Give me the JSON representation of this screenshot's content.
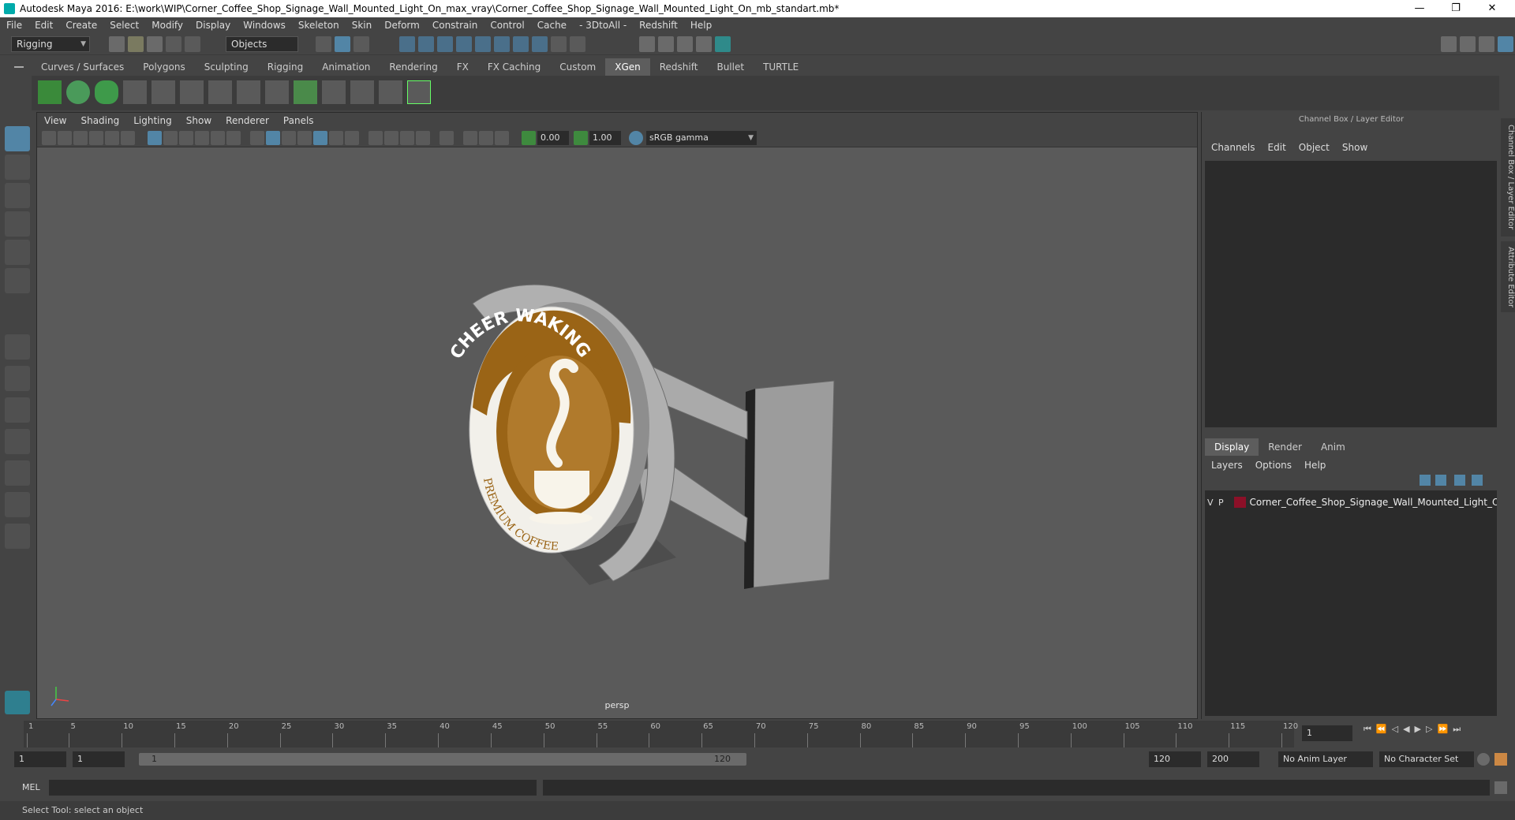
{
  "titlebar": {
    "title": "Autodesk Maya 2016: E:\\work\\WIP\\Corner_Coffee_Shop_Signage_Wall_Mounted_Light_On_max_vray\\Corner_Coffee_Shop_Signage_Wall_Mounted_Light_On_mb_standart.mb*",
    "minimize": "—",
    "restore": "❐",
    "close": "✕"
  },
  "menubar": {
    "items": [
      "File",
      "Edit",
      "Create",
      "Select",
      "Modify",
      "Display",
      "Windows",
      "Skeleton",
      "Skin",
      "Deform",
      "Constrain",
      "Control",
      "Cache",
      "- 3DtoAll -",
      "Redshift",
      "Help"
    ]
  },
  "toolbar": {
    "mode": "Rigging",
    "select_mask": "Objects"
  },
  "shelf": {
    "tabs": [
      "Curves / Surfaces",
      "Polygons",
      "Sculpting",
      "Rigging",
      "Animation",
      "Rendering",
      "FX",
      "FX Caching",
      "Custom",
      "XGen",
      "Redshift",
      "Bullet",
      "TURTLE"
    ],
    "active_tab": "XGen"
  },
  "viewport": {
    "menu": [
      "View",
      "Shading",
      "Lighting",
      "Show",
      "Renderer",
      "Panels"
    ],
    "exposure": "0.00",
    "gamma": "1.00",
    "color_space": "sRGB gamma",
    "camera": "persp",
    "sign": {
      "top_text": "CHEER WAKING",
      "bottom_text": "PREMIUM COFFEE"
    }
  },
  "right_panel": {
    "header": "Channel Box / Layer Editor",
    "channel_menu": [
      "Channels",
      "Edit",
      "Object",
      "Show"
    ],
    "layer_tabs": [
      "Display",
      "Render",
      "Anim"
    ],
    "active_layer_tab": "Display",
    "layer_menu": [
      "Layers",
      "Options",
      "Help"
    ],
    "layer": {
      "v": "V",
      "p": "P",
      "name": "Corner_Coffee_Shop_Signage_Wall_Mounted_Light_On",
      "color": "#8c1028"
    },
    "side_tabs": [
      "Channel Box / Layer Editor",
      "Attribute Editor"
    ]
  },
  "timeline": {
    "ticks": [
      "1",
      "5",
      "10",
      "15",
      "20",
      "25",
      "30",
      "35",
      "40",
      "45",
      "50",
      "55",
      "60",
      "65",
      "70",
      "75",
      "80",
      "85",
      "90",
      "95",
      "100",
      "105",
      "110",
      "115",
      "120"
    ],
    "current_frame": "1"
  },
  "range": {
    "start": "1",
    "anim_start": "1",
    "slider_start": "1",
    "slider_end": "120",
    "end": "120",
    "anim_end": "200",
    "anim_layer": "No Anim Layer",
    "char_set": "No Character Set"
  },
  "mel": {
    "label": "MEL"
  },
  "status": {
    "text": "Select Tool: select an object"
  },
  "colors": {
    "accent": "#5285a6",
    "sign_brown": "#9a6416",
    "layer_red": "#8c1028"
  }
}
